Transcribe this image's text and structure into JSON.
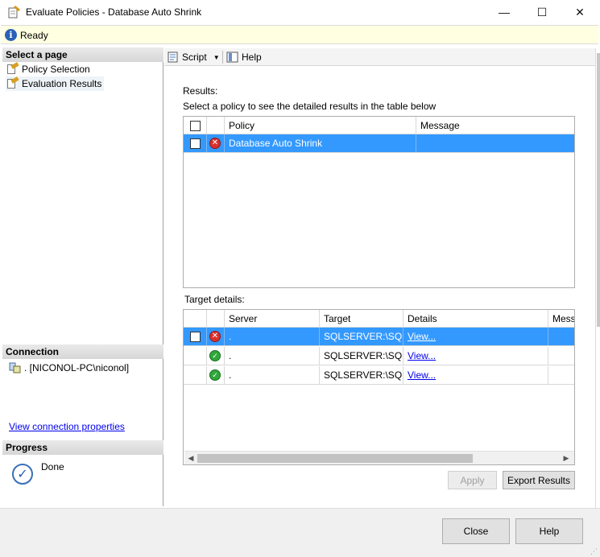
{
  "window": {
    "title": "Evaluate Policies - Database Auto Shrink",
    "controls": {
      "minimize": "—",
      "maximize": "☐",
      "close": "✕"
    }
  },
  "status": {
    "text": "Ready",
    "icon": "info-icon"
  },
  "left_pane": {
    "select_page_header": "Select a page",
    "pages": [
      {
        "label": "Policy Selection",
        "icon": "page-wand-icon"
      },
      {
        "label": "Evaluation Results",
        "icon": "page-wand-icon"
      }
    ],
    "connection_header": "Connection",
    "connection_text": ". [NICONOL-PC\\niconol]",
    "connection_link": "View connection properties",
    "progress_header": "Progress",
    "progress_text": "Done"
  },
  "toolbar": {
    "script_label": "Script",
    "help_label": "Help"
  },
  "results": {
    "label": "Results:",
    "subtitle": "Select a policy to see the detailed results in the table below",
    "columns": [
      "Policy",
      "Message"
    ],
    "rows": [
      {
        "status": "error",
        "policy": "Database Auto Shrink",
        "message": "",
        "selected": true
      }
    ]
  },
  "targets": {
    "label": "Target details:",
    "columns": [
      "Server",
      "Target",
      "Details",
      "Mess"
    ],
    "rows": [
      {
        "status": "error",
        "server": ".",
        "target": "SQLSERVER:\\SQ...",
        "details": "View...",
        "selected": true
      },
      {
        "status": "ok",
        "server": ".",
        "target": "SQLSERVER:\\SQ...",
        "details": "View...",
        "selected": false
      },
      {
        "status": "ok",
        "server": ".",
        "target": "SQLSERVER:\\SQ...",
        "details": "View...",
        "selected": false
      }
    ]
  },
  "buttons": {
    "apply": "Apply",
    "export": "Export Results",
    "close": "Close",
    "help": "Help"
  }
}
